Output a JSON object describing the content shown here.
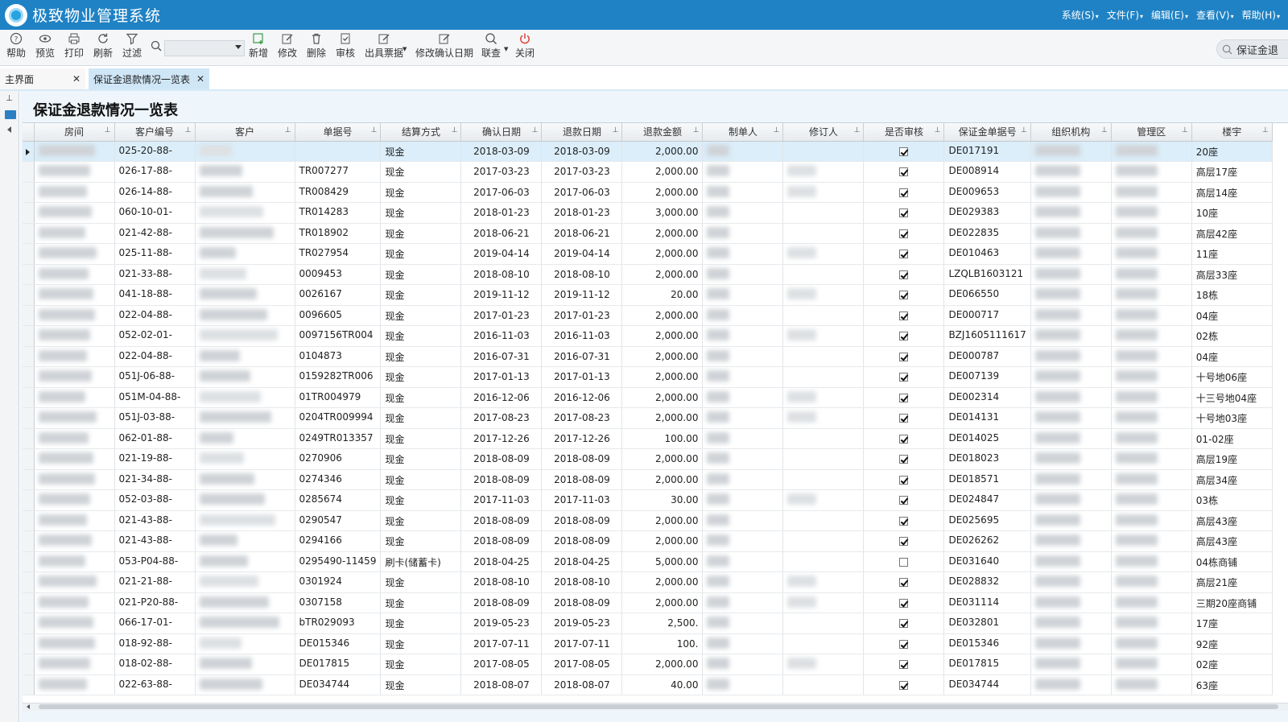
{
  "app": {
    "title": "极致物业管理系统",
    "menus": [
      "系统(S)",
      "文件(F)",
      "编辑(E)",
      "查看(V)",
      "帮助(H)"
    ]
  },
  "toolbar": {
    "help": "帮助",
    "preview": "预览",
    "print": "打印",
    "refresh": "刷新",
    "filter": "过滤",
    "add": "新增",
    "edit": "修改",
    "delete": "删除",
    "audit": "审核",
    "issue_ticket": "出具票据",
    "edit_confirm_date": "修改确认日期",
    "linked_query": "联查",
    "close": "关闭",
    "global_search": "保证金退"
  },
  "tabs": {
    "home": "主界面",
    "active": "保证金退款情况一览表"
  },
  "page": {
    "title": "保证金退款情况一览表"
  },
  "table": {
    "columns": [
      "房间",
      "客户编号",
      "客户",
      "单据号",
      "结算方式",
      "确认日期",
      "退款日期",
      "退款金额",
      "制单人",
      "修订人",
      "是否审核",
      "保证金单据号",
      "组织机构",
      "管理区",
      "楼宇"
    ],
    "rows": [
      {
        "cust_no": "025-20-88-",
        "doc_no": "",
        "method": "现金",
        "confirm": "2018-03-09",
        "refund": "2018-03-09",
        "amount": "2,000.00",
        "audited": true,
        "deposit_no": "DE017191",
        "building": "20座"
      },
      {
        "cust_no": "026-17-88-",
        "doc_no": "TR007277",
        "method": "现金",
        "confirm": "2017-03-23",
        "refund": "2017-03-23",
        "amount": "2,000.00",
        "audited": true,
        "deposit_no": "DE008914",
        "building": "高层17座"
      },
      {
        "cust_no": "026-14-88-",
        "doc_no": "TR008429",
        "method": "现金",
        "confirm": "2017-06-03",
        "refund": "2017-06-03",
        "amount": "2,000.00",
        "audited": true,
        "deposit_no": "DE009653",
        "building": "高层14座"
      },
      {
        "cust_no": "060-10-01-",
        "doc_no": "TR014283",
        "method": "现金",
        "confirm": "2018-01-23",
        "refund": "2018-01-23",
        "amount": "3,000.00",
        "audited": true,
        "deposit_no": "DE029383",
        "building": "10座"
      },
      {
        "cust_no": "021-42-88-",
        "doc_no": "TR018902",
        "method": "现金",
        "confirm": "2018-06-21",
        "refund": "2018-06-21",
        "amount": "2,000.00",
        "audited": true,
        "deposit_no": "DE022835",
        "building": "高层42座"
      },
      {
        "cust_no": "025-11-88-",
        "doc_no": "TR027954",
        "method": "现金",
        "confirm": "2019-04-14",
        "refund": "2019-04-14",
        "amount": "2,000.00",
        "audited": true,
        "deposit_no": "DE010463",
        "building": "11座"
      },
      {
        "cust_no": "021-33-88-",
        "doc_no": "0009453",
        "method": "现金",
        "confirm": "2018-08-10",
        "refund": "2018-08-10",
        "amount": "2,000.00",
        "audited": true,
        "deposit_no": "LZQLB1603121",
        "building": "高层33座"
      },
      {
        "cust_no": "041-18-88-",
        "doc_no": "0026167",
        "method": "现金",
        "confirm": "2019-11-12",
        "refund": "2019-11-12",
        "amount": "20.00",
        "audited": true,
        "deposit_no": "DE066550",
        "building": "18栋"
      },
      {
        "cust_no": "022-04-88-",
        "doc_no": "0096605",
        "method": "现金",
        "confirm": "2017-01-23",
        "refund": "2017-01-23",
        "amount": "2,000.00",
        "audited": true,
        "deposit_no": "DE000717",
        "building": "04座"
      },
      {
        "cust_no": "052-02-01-",
        "doc_no": "0097156TR004",
        "method": "现金",
        "confirm": "2016-11-03",
        "refund": "2016-11-03",
        "amount": "2,000.00",
        "audited": true,
        "deposit_no": "BZJ1605111617",
        "building": "02栋"
      },
      {
        "cust_no": "022-04-88-",
        "doc_no": "0104873",
        "method": "现金",
        "confirm": "2016-07-31",
        "refund": "2016-07-31",
        "amount": "2,000.00",
        "audited": true,
        "deposit_no": "DE000787",
        "building": "04座"
      },
      {
        "cust_no": "051J-06-88-",
        "doc_no": "0159282TR006",
        "method": "现金",
        "confirm": "2017-01-13",
        "refund": "2017-01-13",
        "amount": "2,000.00",
        "audited": true,
        "deposit_no": "DE007139",
        "building": "十号地06座"
      },
      {
        "cust_no": "051M-04-88-",
        "doc_no": "01TR004979",
        "method": "现金",
        "confirm": "2016-12-06",
        "refund": "2016-12-06",
        "amount": "2,000.00",
        "audited": true,
        "deposit_no": "DE002314",
        "building": "十三号地04座"
      },
      {
        "cust_no": "051J-03-88-",
        "doc_no": "0204TR009994",
        "method": "现金",
        "confirm": "2017-08-23",
        "refund": "2017-08-23",
        "amount": "2,000.00",
        "audited": true,
        "deposit_no": "DE014131",
        "building": "十号地03座"
      },
      {
        "cust_no": "062-01-88-",
        "doc_no": "0249TR013357",
        "method": "现金",
        "confirm": "2017-12-26",
        "refund": "2017-12-26",
        "amount": "100.00",
        "audited": true,
        "deposit_no": "DE014025",
        "building": "01-02座"
      },
      {
        "cust_no": "021-19-88-",
        "doc_no": "0270906",
        "method": "现金",
        "confirm": "2018-08-09",
        "refund": "2018-08-09",
        "amount": "2,000.00",
        "audited": true,
        "deposit_no": "DE018023",
        "building": "高层19座"
      },
      {
        "cust_no": "021-34-88-",
        "doc_no": "0274346",
        "method": "现金",
        "confirm": "2018-08-09",
        "refund": "2018-08-09",
        "amount": "2,000.00",
        "audited": true,
        "deposit_no": "DE018571",
        "building": "高层34座"
      },
      {
        "cust_no": "052-03-88-",
        "doc_no": "0285674",
        "method": "现金",
        "confirm": "2017-11-03",
        "refund": "2017-11-03",
        "amount": "30.00",
        "audited": true,
        "deposit_no": "DE024847",
        "building": "03栋"
      },
      {
        "cust_no": "021-43-88-",
        "doc_no": "0290547",
        "method": "现金",
        "confirm": "2018-08-09",
        "refund": "2018-08-09",
        "amount": "2,000.00",
        "audited": true,
        "deposit_no": "DE025695",
        "building": "高层43座"
      },
      {
        "cust_no": "021-43-88-",
        "doc_no": "0294166",
        "method": "现金",
        "confirm": "2018-08-09",
        "refund": "2018-08-09",
        "amount": "2,000.00",
        "audited": true,
        "deposit_no": "DE026262",
        "building": "高层43座"
      },
      {
        "cust_no": "053-P04-88-",
        "doc_no": "0295490-11459",
        "method": "刷卡(储蓄卡)",
        "confirm": "2018-04-25",
        "refund": "2018-04-25",
        "amount": "5,000.00",
        "audited": false,
        "deposit_no": "DE031640",
        "building": "04栋商铺"
      },
      {
        "cust_no": "021-21-88-",
        "doc_no": "0301924",
        "method": "现金",
        "confirm": "2018-08-10",
        "refund": "2018-08-10",
        "amount": "2,000.00",
        "audited": true,
        "deposit_no": "DE028832",
        "building": "高层21座"
      },
      {
        "cust_no": "021-P20-88-",
        "doc_no": "0307158",
        "method": "现金",
        "confirm": "2018-08-09",
        "refund": "2018-08-09",
        "amount": "2,000.00",
        "audited": true,
        "deposit_no": "DE031114",
        "building": "三期20座商铺"
      },
      {
        "cust_no": "066-17-01-",
        "doc_no": "bTR029093",
        "method": "现金",
        "confirm": "2019-05-23",
        "refund": "2019-05-23",
        "amount": "2,500.",
        "audited": true,
        "deposit_no": "DE032801",
        "building": "17座"
      },
      {
        "cust_no": "018-92-88-",
        "doc_no": "DE015346",
        "method": "现金",
        "confirm": "2017-07-11",
        "refund": "2017-07-11",
        "amount": "100.",
        "audited": true,
        "deposit_no": "DE015346",
        "building": "92座"
      },
      {
        "cust_no": "018-02-88-",
        "doc_no": "DE017815",
        "method": "现金",
        "confirm": "2017-08-05",
        "refund": "2017-08-05",
        "amount": "2,000.00",
        "audited": true,
        "deposit_no": "DE017815",
        "building": "02座"
      },
      {
        "cust_no": "022-63-88-",
        "doc_no": "DE034744",
        "method": "现金",
        "confirm": "2018-08-07",
        "refund": "2018-08-07",
        "amount": "40.00",
        "audited": true,
        "deposit_no": "DE034744",
        "building": "63座"
      }
    ]
  }
}
